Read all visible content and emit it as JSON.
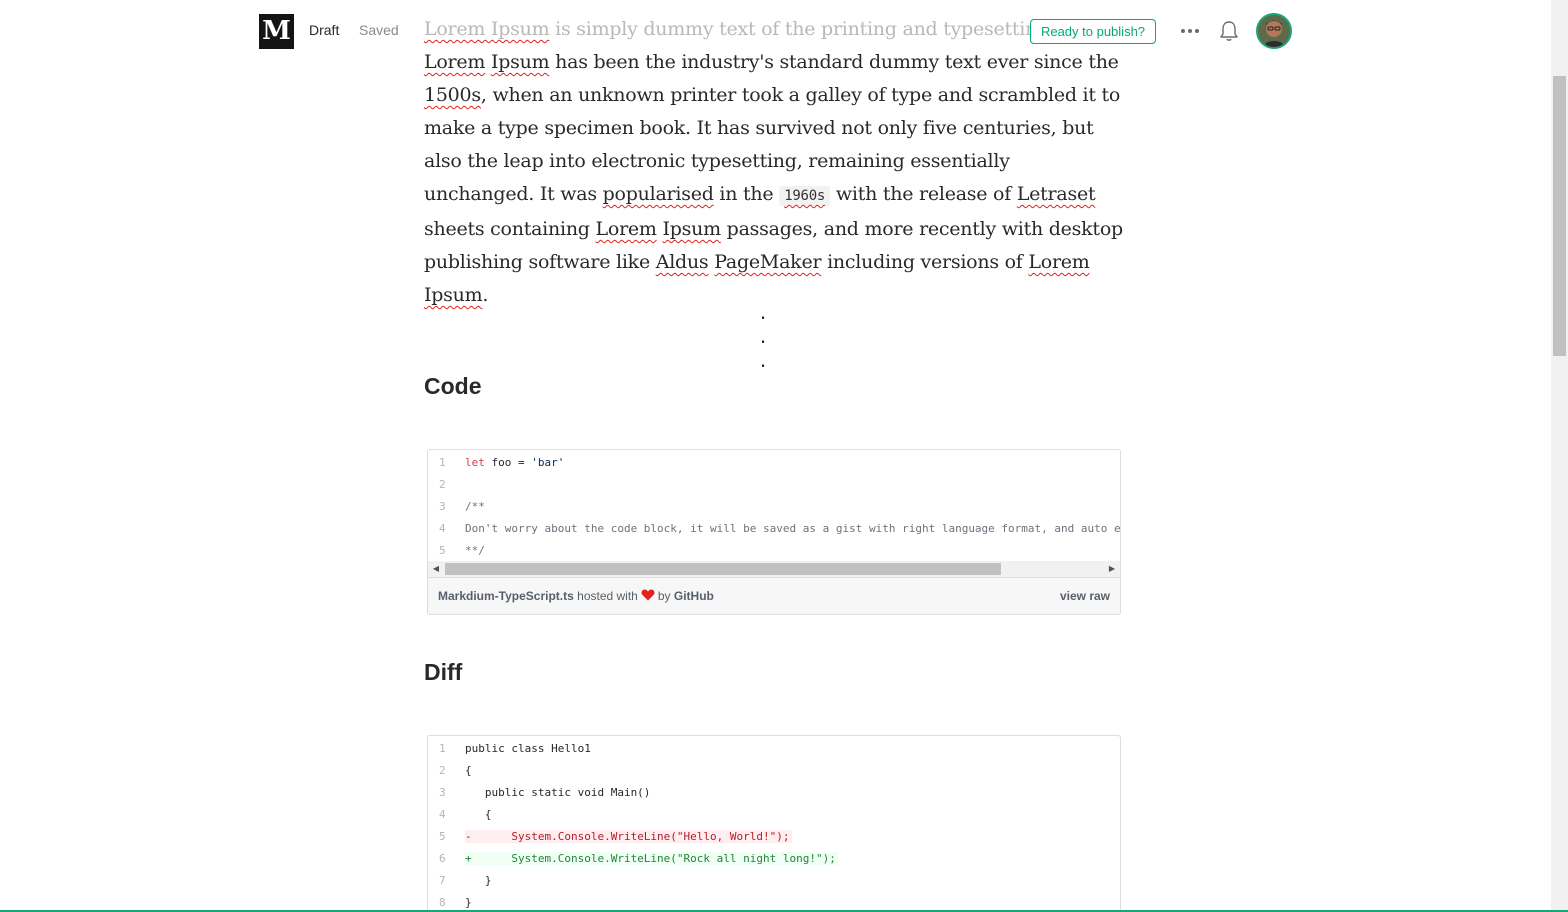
{
  "header": {
    "logo_letter": "M",
    "draft_label": "Draft",
    "saved_label": "Saved",
    "publish_label": "Ready to publish?",
    "more_icon": "more-horizontal-icon",
    "bell_icon": "bell-icon",
    "accent_color": "#03a87c"
  },
  "article": {
    "paragraph": {
      "p0": "Lorem Ipsum",
      "p1": " is simply dummy text of the printing and typesetting in",
      "p2": "Lorem",
      "p3": " ",
      "p4": "Ipsum",
      "p5": " has been the industry's standard dummy text ever since the ",
      "p6": "1500s",
      "p7": ", when an unknown printer took a galley of type and scrambled it to make a type specimen book. It has survived not only five centuries, but also the leap into electronic typesetting, remaining essentially unchanged. It was ",
      "p8": "popularised",
      "p9": " in the ",
      "p10": "1960s",
      "p11": " with the release of ",
      "p12": "Letraset",
      "p13": " sheets containing ",
      "p14": "Lorem",
      "p15": " ",
      "p16": "Ipsum",
      "p17": " passages, and more recently with desktop publishing software like ",
      "p18": "Aldus",
      "p19": " ",
      "p20": "PageMaker",
      "p21": " including versions of ",
      "p22": "Lorem",
      "p23": " ",
      "p24": "Ipsum",
      "p25": "."
    },
    "separator": "· · ·",
    "heading_code": "Code",
    "heading_diff": "Diff"
  },
  "gist_code": {
    "lines": [
      {
        "n": "1",
        "kw": "let",
        "rest": " foo = ",
        "str": "'bar'"
      },
      {
        "n": "2",
        "text": ""
      },
      {
        "n": "3",
        "text": "/**"
      },
      {
        "n": "4",
        "text": "Don't worry about the code block, it will be saved as a gist with right language format, and auto em"
      },
      {
        "n": "5",
        "text": "**/"
      }
    ],
    "filename": "Markdium-TypeScript.ts",
    "hosted_with": "hosted with",
    "by": "by",
    "github": "GitHub",
    "view_raw": "view raw"
  },
  "gist_diff": {
    "lines": [
      {
        "n": "1",
        "text": "public class Hello1"
      },
      {
        "n": "2",
        "text": "{"
      },
      {
        "n": "3",
        "text": "   public static void Main()"
      },
      {
        "n": "4",
        "text": "   {"
      },
      {
        "n": "5",
        "marker": "-",
        "text": "      System.Console.WriteLine(\"Hello, World!\");"
      },
      {
        "n": "6",
        "marker": "+",
        "text": "      System.Console.WriteLine(\"Rock all night long!\");"
      },
      {
        "n": "7",
        "text": "   }"
      },
      {
        "n": "8",
        "text": "}"
      }
    ]
  }
}
